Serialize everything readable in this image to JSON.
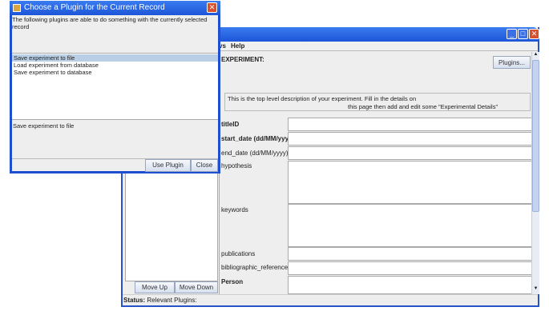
{
  "main_window": {
    "menu": [
      "vs",
      "Help"
    ],
    "left_pane": {
      "move_up": "Move Up",
      "move_down": "Move Down"
    },
    "status": {
      "label": "Status:",
      "text": "Relevant Plugins:"
    },
    "form": {
      "heading": "EXPERIMENT:",
      "plugins_button": "Plugins...",
      "description_line1": "This is the top level description of your experiment. Fill in the details on",
      "description_line2": "this page then add and edit some \"Experimental Details\"",
      "fields": [
        "titleID",
        "start_date (dd/MM/yyyy)",
        "end_date (dd/MM/yyyy)",
        "hypothesis",
        "keywords",
        "publications",
        "bibliographic_references",
        "Person"
      ]
    }
  },
  "dialog": {
    "title": "Choose a Plugin for the Current Record",
    "message": "The following plugins are able to do something with the currently selected record",
    "plugins": [
      "Save experiment to file",
      "Load experiment from database",
      "Save experiment to database"
    ],
    "selected_description": "Save experiment to file",
    "use_plugin": "Use Plugin",
    "close": "Close"
  }
}
